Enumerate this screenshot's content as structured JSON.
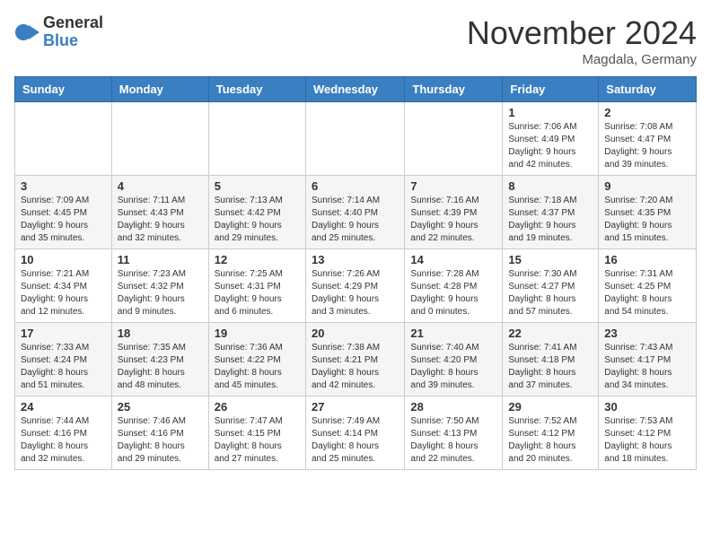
{
  "logo": {
    "general": "General",
    "blue": "Blue"
  },
  "title": "November 2024",
  "location": "Magdala, Germany",
  "days_of_week": [
    "Sunday",
    "Monday",
    "Tuesday",
    "Wednesday",
    "Thursday",
    "Friday",
    "Saturday"
  ],
  "weeks": [
    [
      {
        "day": "",
        "info": ""
      },
      {
        "day": "",
        "info": ""
      },
      {
        "day": "",
        "info": ""
      },
      {
        "day": "",
        "info": ""
      },
      {
        "day": "",
        "info": ""
      },
      {
        "day": "1",
        "info": "Sunrise: 7:06 AM\nSunset: 4:49 PM\nDaylight: 9 hours\nand 42 minutes."
      },
      {
        "day": "2",
        "info": "Sunrise: 7:08 AM\nSunset: 4:47 PM\nDaylight: 9 hours\nand 39 minutes."
      }
    ],
    [
      {
        "day": "3",
        "info": "Sunrise: 7:09 AM\nSunset: 4:45 PM\nDaylight: 9 hours\nand 35 minutes."
      },
      {
        "day": "4",
        "info": "Sunrise: 7:11 AM\nSunset: 4:43 PM\nDaylight: 9 hours\nand 32 minutes."
      },
      {
        "day": "5",
        "info": "Sunrise: 7:13 AM\nSunset: 4:42 PM\nDaylight: 9 hours\nand 29 minutes."
      },
      {
        "day": "6",
        "info": "Sunrise: 7:14 AM\nSunset: 4:40 PM\nDaylight: 9 hours\nand 25 minutes."
      },
      {
        "day": "7",
        "info": "Sunrise: 7:16 AM\nSunset: 4:39 PM\nDaylight: 9 hours\nand 22 minutes."
      },
      {
        "day": "8",
        "info": "Sunrise: 7:18 AM\nSunset: 4:37 PM\nDaylight: 9 hours\nand 19 minutes."
      },
      {
        "day": "9",
        "info": "Sunrise: 7:20 AM\nSunset: 4:35 PM\nDaylight: 9 hours\nand 15 minutes."
      }
    ],
    [
      {
        "day": "10",
        "info": "Sunrise: 7:21 AM\nSunset: 4:34 PM\nDaylight: 9 hours\nand 12 minutes."
      },
      {
        "day": "11",
        "info": "Sunrise: 7:23 AM\nSunset: 4:32 PM\nDaylight: 9 hours\nand 9 minutes."
      },
      {
        "day": "12",
        "info": "Sunrise: 7:25 AM\nSunset: 4:31 PM\nDaylight: 9 hours\nand 6 minutes."
      },
      {
        "day": "13",
        "info": "Sunrise: 7:26 AM\nSunset: 4:29 PM\nDaylight: 9 hours\nand 3 minutes."
      },
      {
        "day": "14",
        "info": "Sunrise: 7:28 AM\nSunset: 4:28 PM\nDaylight: 9 hours\nand 0 minutes."
      },
      {
        "day": "15",
        "info": "Sunrise: 7:30 AM\nSunset: 4:27 PM\nDaylight: 8 hours\nand 57 minutes."
      },
      {
        "day": "16",
        "info": "Sunrise: 7:31 AM\nSunset: 4:25 PM\nDaylight: 8 hours\nand 54 minutes."
      }
    ],
    [
      {
        "day": "17",
        "info": "Sunrise: 7:33 AM\nSunset: 4:24 PM\nDaylight: 8 hours\nand 51 minutes."
      },
      {
        "day": "18",
        "info": "Sunrise: 7:35 AM\nSunset: 4:23 PM\nDaylight: 8 hours\nand 48 minutes."
      },
      {
        "day": "19",
        "info": "Sunrise: 7:36 AM\nSunset: 4:22 PM\nDaylight: 8 hours\nand 45 minutes."
      },
      {
        "day": "20",
        "info": "Sunrise: 7:38 AM\nSunset: 4:21 PM\nDaylight: 8 hours\nand 42 minutes."
      },
      {
        "day": "21",
        "info": "Sunrise: 7:40 AM\nSunset: 4:20 PM\nDaylight: 8 hours\nand 39 minutes."
      },
      {
        "day": "22",
        "info": "Sunrise: 7:41 AM\nSunset: 4:18 PM\nDaylight: 8 hours\nand 37 minutes."
      },
      {
        "day": "23",
        "info": "Sunrise: 7:43 AM\nSunset: 4:17 PM\nDaylight: 8 hours\nand 34 minutes."
      }
    ],
    [
      {
        "day": "24",
        "info": "Sunrise: 7:44 AM\nSunset: 4:16 PM\nDaylight: 8 hours\nand 32 minutes."
      },
      {
        "day": "25",
        "info": "Sunrise: 7:46 AM\nSunset: 4:16 PM\nDaylight: 8 hours\nand 29 minutes."
      },
      {
        "day": "26",
        "info": "Sunrise: 7:47 AM\nSunset: 4:15 PM\nDaylight: 8 hours\nand 27 minutes."
      },
      {
        "day": "27",
        "info": "Sunrise: 7:49 AM\nSunset: 4:14 PM\nDaylight: 8 hours\nand 25 minutes."
      },
      {
        "day": "28",
        "info": "Sunrise: 7:50 AM\nSunset: 4:13 PM\nDaylight: 8 hours\nand 22 minutes."
      },
      {
        "day": "29",
        "info": "Sunrise: 7:52 AM\nSunset: 4:12 PM\nDaylight: 8 hours\nand 20 minutes."
      },
      {
        "day": "30",
        "info": "Sunrise: 7:53 AM\nSunset: 4:12 PM\nDaylight: 8 hours\nand 18 minutes."
      }
    ]
  ]
}
